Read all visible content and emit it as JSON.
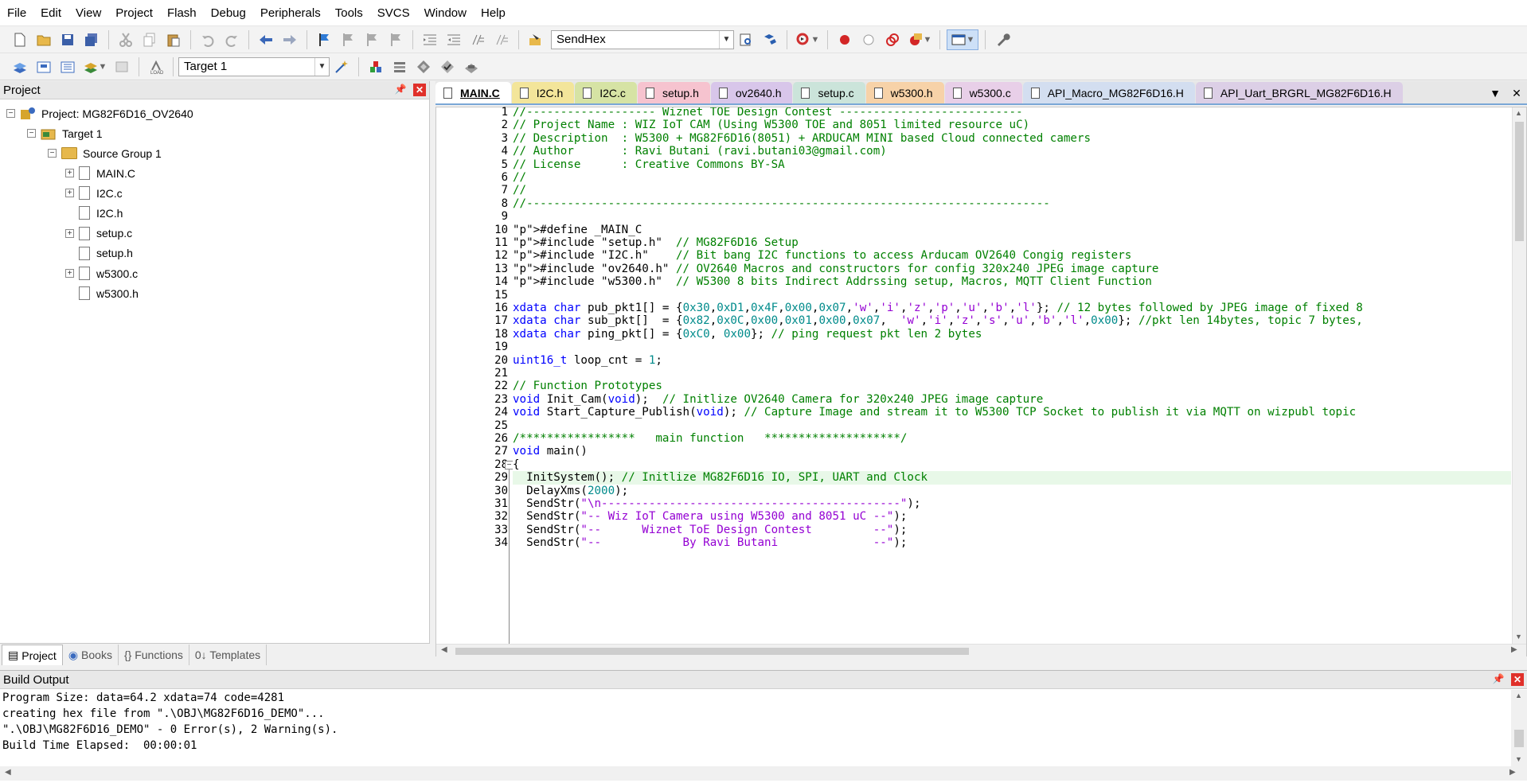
{
  "menubar": [
    "File",
    "Edit",
    "View",
    "Project",
    "Flash",
    "Debug",
    "Peripherals",
    "Tools",
    "SVCS",
    "Window",
    "Help"
  ],
  "toolbar1": {
    "find_combo": "SendHex"
  },
  "toolbar2": {
    "target_combo": "Target 1"
  },
  "project_panel": {
    "title": "Project",
    "root": "Project: MG82F6D16_OV2640",
    "target": "Target 1",
    "group": "Source Group 1",
    "files": [
      {
        "name": "MAIN.C",
        "expandable": true
      },
      {
        "name": "I2C.c",
        "expandable": true
      },
      {
        "name": "I2C.h",
        "expandable": false
      },
      {
        "name": "setup.c",
        "expandable": true
      },
      {
        "name": "setup.h",
        "expandable": false
      },
      {
        "name": "w5300.c",
        "expandable": true
      },
      {
        "name": "w5300.h",
        "expandable": false
      }
    ],
    "tabs": [
      "Project",
      "Books",
      "{} Functions",
      "0↓ Templates"
    ]
  },
  "editor_tabs": [
    {
      "label": "MAIN.C",
      "color": "#ffffff",
      "active": true
    },
    {
      "label": "I2C.h",
      "color": "#f3e59a"
    },
    {
      "label": "I2C.c",
      "color": "#d6e3a4"
    },
    {
      "label": "setup.h",
      "color": "#f6c3cf"
    },
    {
      "label": "ov2640.h",
      "color": "#d8c6ea"
    },
    {
      "label": "setup.c",
      "color": "#cbe4da"
    },
    {
      "label": "w5300.h",
      "color": "#f7d2a8"
    },
    {
      "label": "w5300.c",
      "color": "#e8cfe8"
    },
    {
      "label": "API_Macro_MG82F6D16.H",
      "color": "#d3def0"
    },
    {
      "label": "API_Uart_BRGRL_MG82F6D16.H",
      "color": "#dccfe6"
    }
  ],
  "code": {
    "current_line": 29,
    "lines": [
      "//------------------- Wiznet TOE Design Contest ---------------------------",
      "// Project Name : WIZ IoT CAM (Using W5300 TOE and 8051 limited resource uC)",
      "// Description  : W5300 + MG82F6D16(8051) + ARDUCAM MINI based Cloud connected camers",
      "// Author       : Ravi Butani (ravi.butani03@gmail.com)",
      "// License      : Creative Commons BY-SA",
      "//",
      "//",
      "//-----------------------------------------------------------------------------",
      "",
      "#define _MAIN_C",
      "#include \"setup.h\"  // MG82F6D16 Setup",
      "#include \"I2C.h\"    // Bit bang I2C functions to access Arducam OV2640 Congig registers",
      "#include \"ov2640.h\" // OV2640 Macros and constructors for config 320x240 JPEG image capture",
      "#include \"w5300.h\"  // W5300 8 bits Indirect Addrssing setup, Macros, MQTT Client Function",
      "",
      "xdata char pub_pkt1[] = {0x30,0xD1,0x4F,0x00,0x07,'w','i','z','p','u','b','l'}; // 12 bytes followed by JPEG image of fixed 8",
      "xdata char sub_pkt[]  = {0x82,0x0C,0x00,0x01,0x00,0x07,  'w','i','z','s','u','b','l',0x00}; //pkt len 14bytes, topic 7 bytes,",
      "xdata char ping_pkt[] = {0xC0, 0x00}; // ping request pkt len 2 bytes",
      "",
      "uint16_t loop_cnt = 1;",
      "",
      "// Function Prototypes",
      "void Init_Cam(void);  // Initlize OV2640 Camera for 320x240 JPEG image capture",
      "void Start_Capture_Publish(void); // Capture Image and stream it to W5300 TCP Socket to publish it via MQTT on wizpubl topic",
      "",
      "/*****************   main function   ********************/",
      "void main()",
      "{",
      "  InitSystem(); // Initlize MG82F6D16 IO, SPI, UART and Clock",
      "  DelayXms(2000);",
      "  SendStr(\"\\n--------------------------------------------\");",
      "  SendStr(\"-- Wiz IoT Camera using W5300 and 8051 uC --\");",
      "  SendStr(\"--      Wiznet ToE Design Contest         --\");",
      "  SendStr(\"--            By Ravi Butani              --\");"
    ]
  },
  "build_output": {
    "title": "Build Output",
    "lines": [
      "Program Size: data=64.2 xdata=74 code=4281",
      "creating hex file from \".\\OBJ\\MG82F6D16_DEMO\"...",
      "\".\\OBJ\\MG82F6D16_DEMO\" - 0 Error(s), 2 Warning(s).",
      "Build Time Elapsed:  00:00:01"
    ]
  },
  "icons": [
    "new-file",
    "open-folder",
    "save",
    "save-all",
    "cut",
    "copy",
    "paste",
    "undo",
    "redo",
    "nav-back",
    "nav-forward",
    "bookmark",
    "bookmark-prev",
    "bookmark-next",
    "bookmark-clear",
    "indent",
    "unindent",
    "comment",
    "uncomment",
    "find-in-files",
    "find",
    "debug-start",
    "breakpoint-insert",
    "breakpoint-disable",
    "breakpoint-kill",
    "window-layout",
    "wrench",
    "translate",
    "build",
    "rebuild",
    "batch-build",
    "stop-build",
    "download",
    "target-options",
    "manage",
    "pack-installer",
    "select-pack",
    "manage-runtime"
  ]
}
